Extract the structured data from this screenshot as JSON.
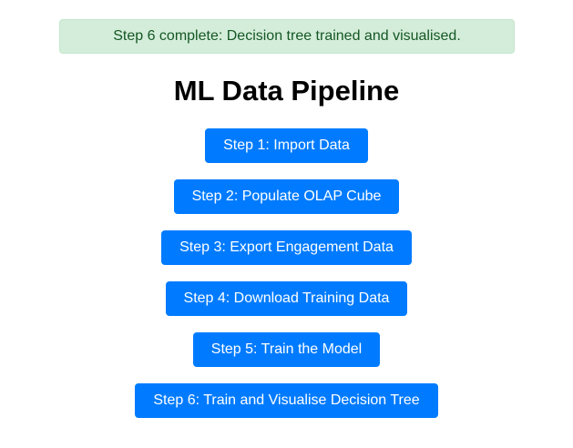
{
  "alert": {
    "message": "Step 6 complete: Decision tree trained and visualised."
  },
  "page": {
    "title": "ML Data Pipeline"
  },
  "steps": [
    {
      "label": "Step 1: Import Data"
    },
    {
      "label": "Step 2: Populate OLAP Cube"
    },
    {
      "label": "Step 3: Export Engagement Data"
    },
    {
      "label": "Step 4: Download Training Data"
    },
    {
      "label": "Step 5: Train the Model"
    },
    {
      "label": "Step 6: Train and Visualise Decision Tree"
    }
  ],
  "colors": {
    "primary": "#007bff",
    "success_bg": "#d4edda",
    "success_text": "#155724"
  }
}
